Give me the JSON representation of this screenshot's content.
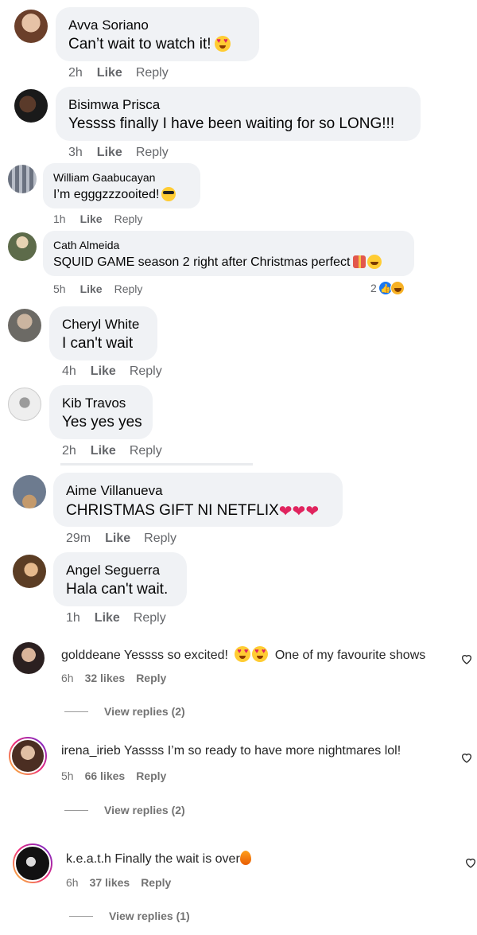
{
  "facebook_comments": [
    {
      "author": "Avva Soriano",
      "text": "Can’t wait to watch it!",
      "time": "2h",
      "like": "Like",
      "reply": "Reply",
      "emoji": "heart-eyes",
      "avatar_color": "#c48b6c"
    },
    {
      "author": "Bisimwa Prisca",
      "text": "Yessss finally I have been waiting for so LONG!!!",
      "time": "3h",
      "like": "Like",
      "reply": "Reply",
      "avatar_color": "#3a2418"
    },
    {
      "author": "William Gaabucayan",
      "text": "I’m egggzzzooited!",
      "time": "1h",
      "like": "Like",
      "reply": "Reply",
      "emoji": "sunglasses",
      "avatar_color": "#7f7f8c"
    },
    {
      "author": "Cath Almeida",
      "text": "SQUID GAME season 2 right after Christmas perfect",
      "time": "5h",
      "like": "Like",
      "reply": "Reply",
      "reaction_count": "2",
      "avatar_color": "#8c7b5a"
    },
    {
      "author": "Cheryl White",
      "text": "I can't wait",
      "time": "4h",
      "like": "Like",
      "reply": "Reply",
      "avatar_color": "#a39a8e"
    },
    {
      "author": "Kib Travos",
      "text": "Yes yes yes",
      "time": "2h",
      "like": "Like",
      "reply": "Reply",
      "avatar_color": "#d8d8d8"
    },
    {
      "author": "Aime Villanueva",
      "text": "CHRISTMAS GIFT NI NETFLIX",
      "time": "29m",
      "like": "Like",
      "reply": "Reply",
      "avatar_color": "#8a96a6"
    },
    {
      "author": "Angel Seguerra",
      "text": "Hala can't wait.",
      "time": "1h",
      "like": "Like",
      "reply": "Reply",
      "avatar_color": "#a2784e"
    }
  ],
  "instagram_comments": [
    {
      "username": "golddeane",
      "text_before": "Yessss so excited!",
      "text_after": "One of my favourite shows",
      "time": "6h",
      "likes": "32 likes",
      "reply": "Reply",
      "view_replies": "View replies (2)",
      "avatar_color": "#3a2a26"
    },
    {
      "username": "irena_irieb",
      "text": "Yassss I’m so ready to have more nightmares lol!",
      "time": "5h",
      "likes": "66 likes",
      "reply": "Reply",
      "view_replies": "View replies (2)",
      "avatar_color": "#8f6a52"
    },
    {
      "username": "k.e.a.t.h",
      "text": "Finally the wait is over",
      "time": "6h",
      "likes": "37 likes",
      "reply": "Reply",
      "view_replies": "View replies (1)",
      "avatar_color": "#111111"
    }
  ]
}
